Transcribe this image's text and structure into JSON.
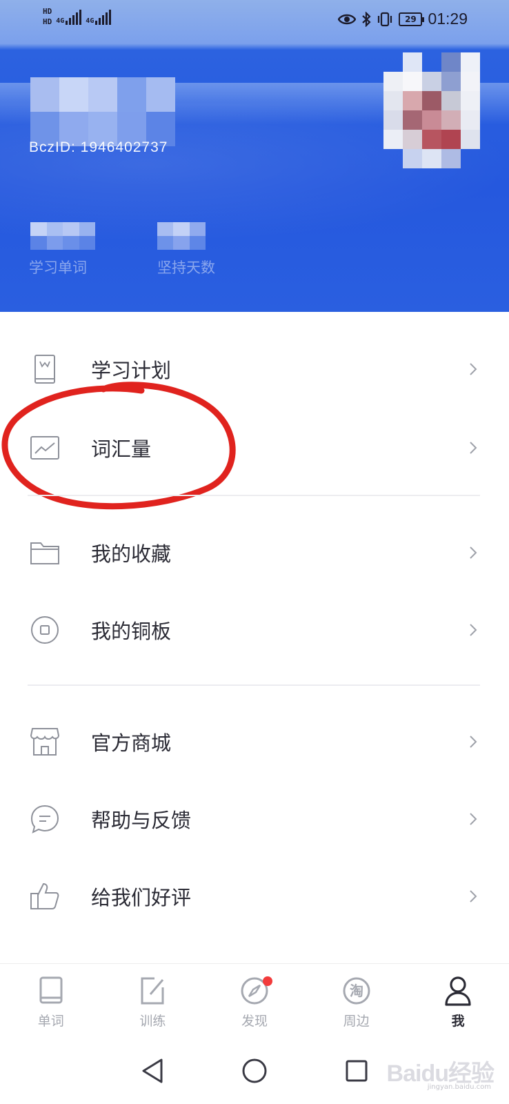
{
  "status_bar": {
    "hd1": "HD",
    "hd2": "HD",
    "net1": "4G",
    "net2": "4G",
    "battery": "29",
    "time": "01:29"
  },
  "profile": {
    "bczid": "BczID: 1946402737",
    "stats": [
      {
        "label": "学习单词"
      },
      {
        "label": "坚持天数"
      }
    ]
  },
  "menu": {
    "items": [
      {
        "label": "学习计划",
        "icon": "book-icon"
      },
      {
        "label": "词汇量",
        "icon": "chart-icon"
      },
      {
        "label": "我的收藏",
        "icon": "folder-icon"
      },
      {
        "label": "我的铜板",
        "icon": "coin-icon"
      },
      {
        "label": "官方商城",
        "icon": "shop-icon"
      },
      {
        "label": "帮助与反馈",
        "icon": "chat-icon"
      },
      {
        "label": "给我们好评",
        "icon": "thumbs-up-icon"
      }
    ]
  },
  "tabs": [
    {
      "label": "单词",
      "icon": "book-icon",
      "active": false
    },
    {
      "label": "训练",
      "icon": "edit-icon",
      "active": false
    },
    {
      "label": "发现",
      "icon": "compass-icon",
      "active": false,
      "badge": true
    },
    {
      "label": "周边",
      "icon": "taobao-icon",
      "active": false
    },
    {
      "label": "我",
      "icon": "user-icon",
      "active": true
    }
  ],
  "tab_icon_text": {
    "taobao": "淘"
  },
  "watermark": {
    "text": "Baidu经验",
    "sub": "jingyan.baidu.com"
  },
  "colors": {
    "header_blue": "#2558de",
    "annotation_red": "#e0231e",
    "badge_red": "#f23b3b",
    "text_dark": "#2b2b35",
    "text_muted": "#a5a8b0"
  }
}
